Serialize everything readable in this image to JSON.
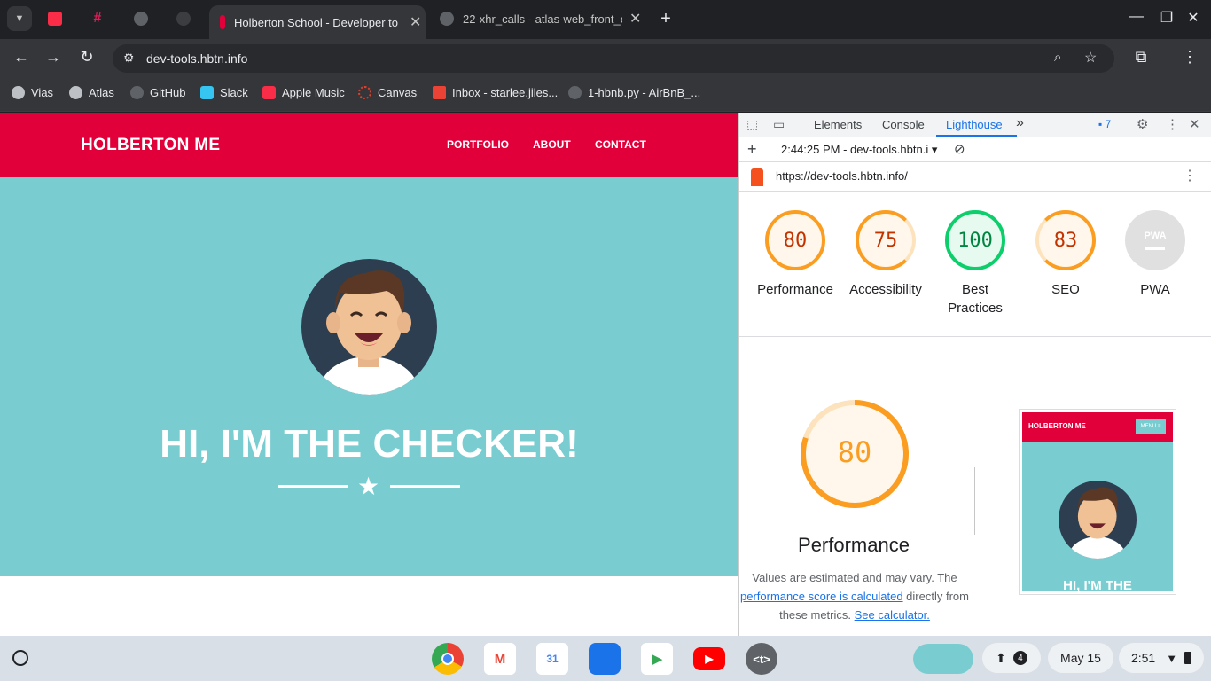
{
  "browser": {
    "tabs": [
      {
        "title": "Holberton School - Developer to"
      },
      {
        "title": "22-xhr_calls - atlas-web_front_e"
      }
    ],
    "new_tab": "+",
    "close_glyph": "✕",
    "url": "dev-tools.hbtn.info",
    "bookmarks": [
      "Vias",
      "Atlas",
      "GitHub",
      "Slack",
      "Apple Music",
      "Canvas",
      "Inbox - starlee.jiles...",
      "1-hbnb.py - AirBnB_..."
    ]
  },
  "site": {
    "logo": "HOLBERTON ME",
    "nav": [
      "PORTFOLIO",
      "ABOUT",
      "CONTACT"
    ],
    "hero_title": "HI, I'M THE CHECKER!",
    "star": "★",
    "colors": {
      "header": "#e2003b",
      "hero": "#79cdd1"
    }
  },
  "devtools": {
    "tabs": [
      "Elements",
      "Console",
      "Lighthouse"
    ],
    "more": "»",
    "issues_count": "7",
    "report_time": "2:44:25 PM - dev-tools.hbtn.i",
    "report_url": "https://dev-tools.hbtn.info/",
    "scores": [
      {
        "score": "80",
        "label": "Performance",
        "color": "#fa9d20"
      },
      {
        "score": "75",
        "label": "Accessibility",
        "color": "#fa9d20"
      },
      {
        "score": "100",
        "label": "Best Practices",
        "color": "#0cce6b"
      },
      {
        "score": "83",
        "label": "SEO",
        "color": "#fa9d20"
      },
      {
        "score": "",
        "label": "PWA",
        "color": "#9aa0a6"
      }
    ],
    "pwa_badge": "PWA",
    "big_score": "80",
    "big_label": "Performance",
    "note_1": "Values are estimated and may vary. The",
    "note_link_1": "performance score is calculated",
    "note_2": "directly from",
    "note_3": "these metrics.",
    "note_link_2": "See calculator.",
    "thumb": {
      "logo": "HOLBERTON ME",
      "menu": "MENU ≡",
      "title": "HI, I'M THE"
    }
  },
  "shelf": {
    "notif_count": "4",
    "date": "May 15",
    "time": "2:51"
  }
}
